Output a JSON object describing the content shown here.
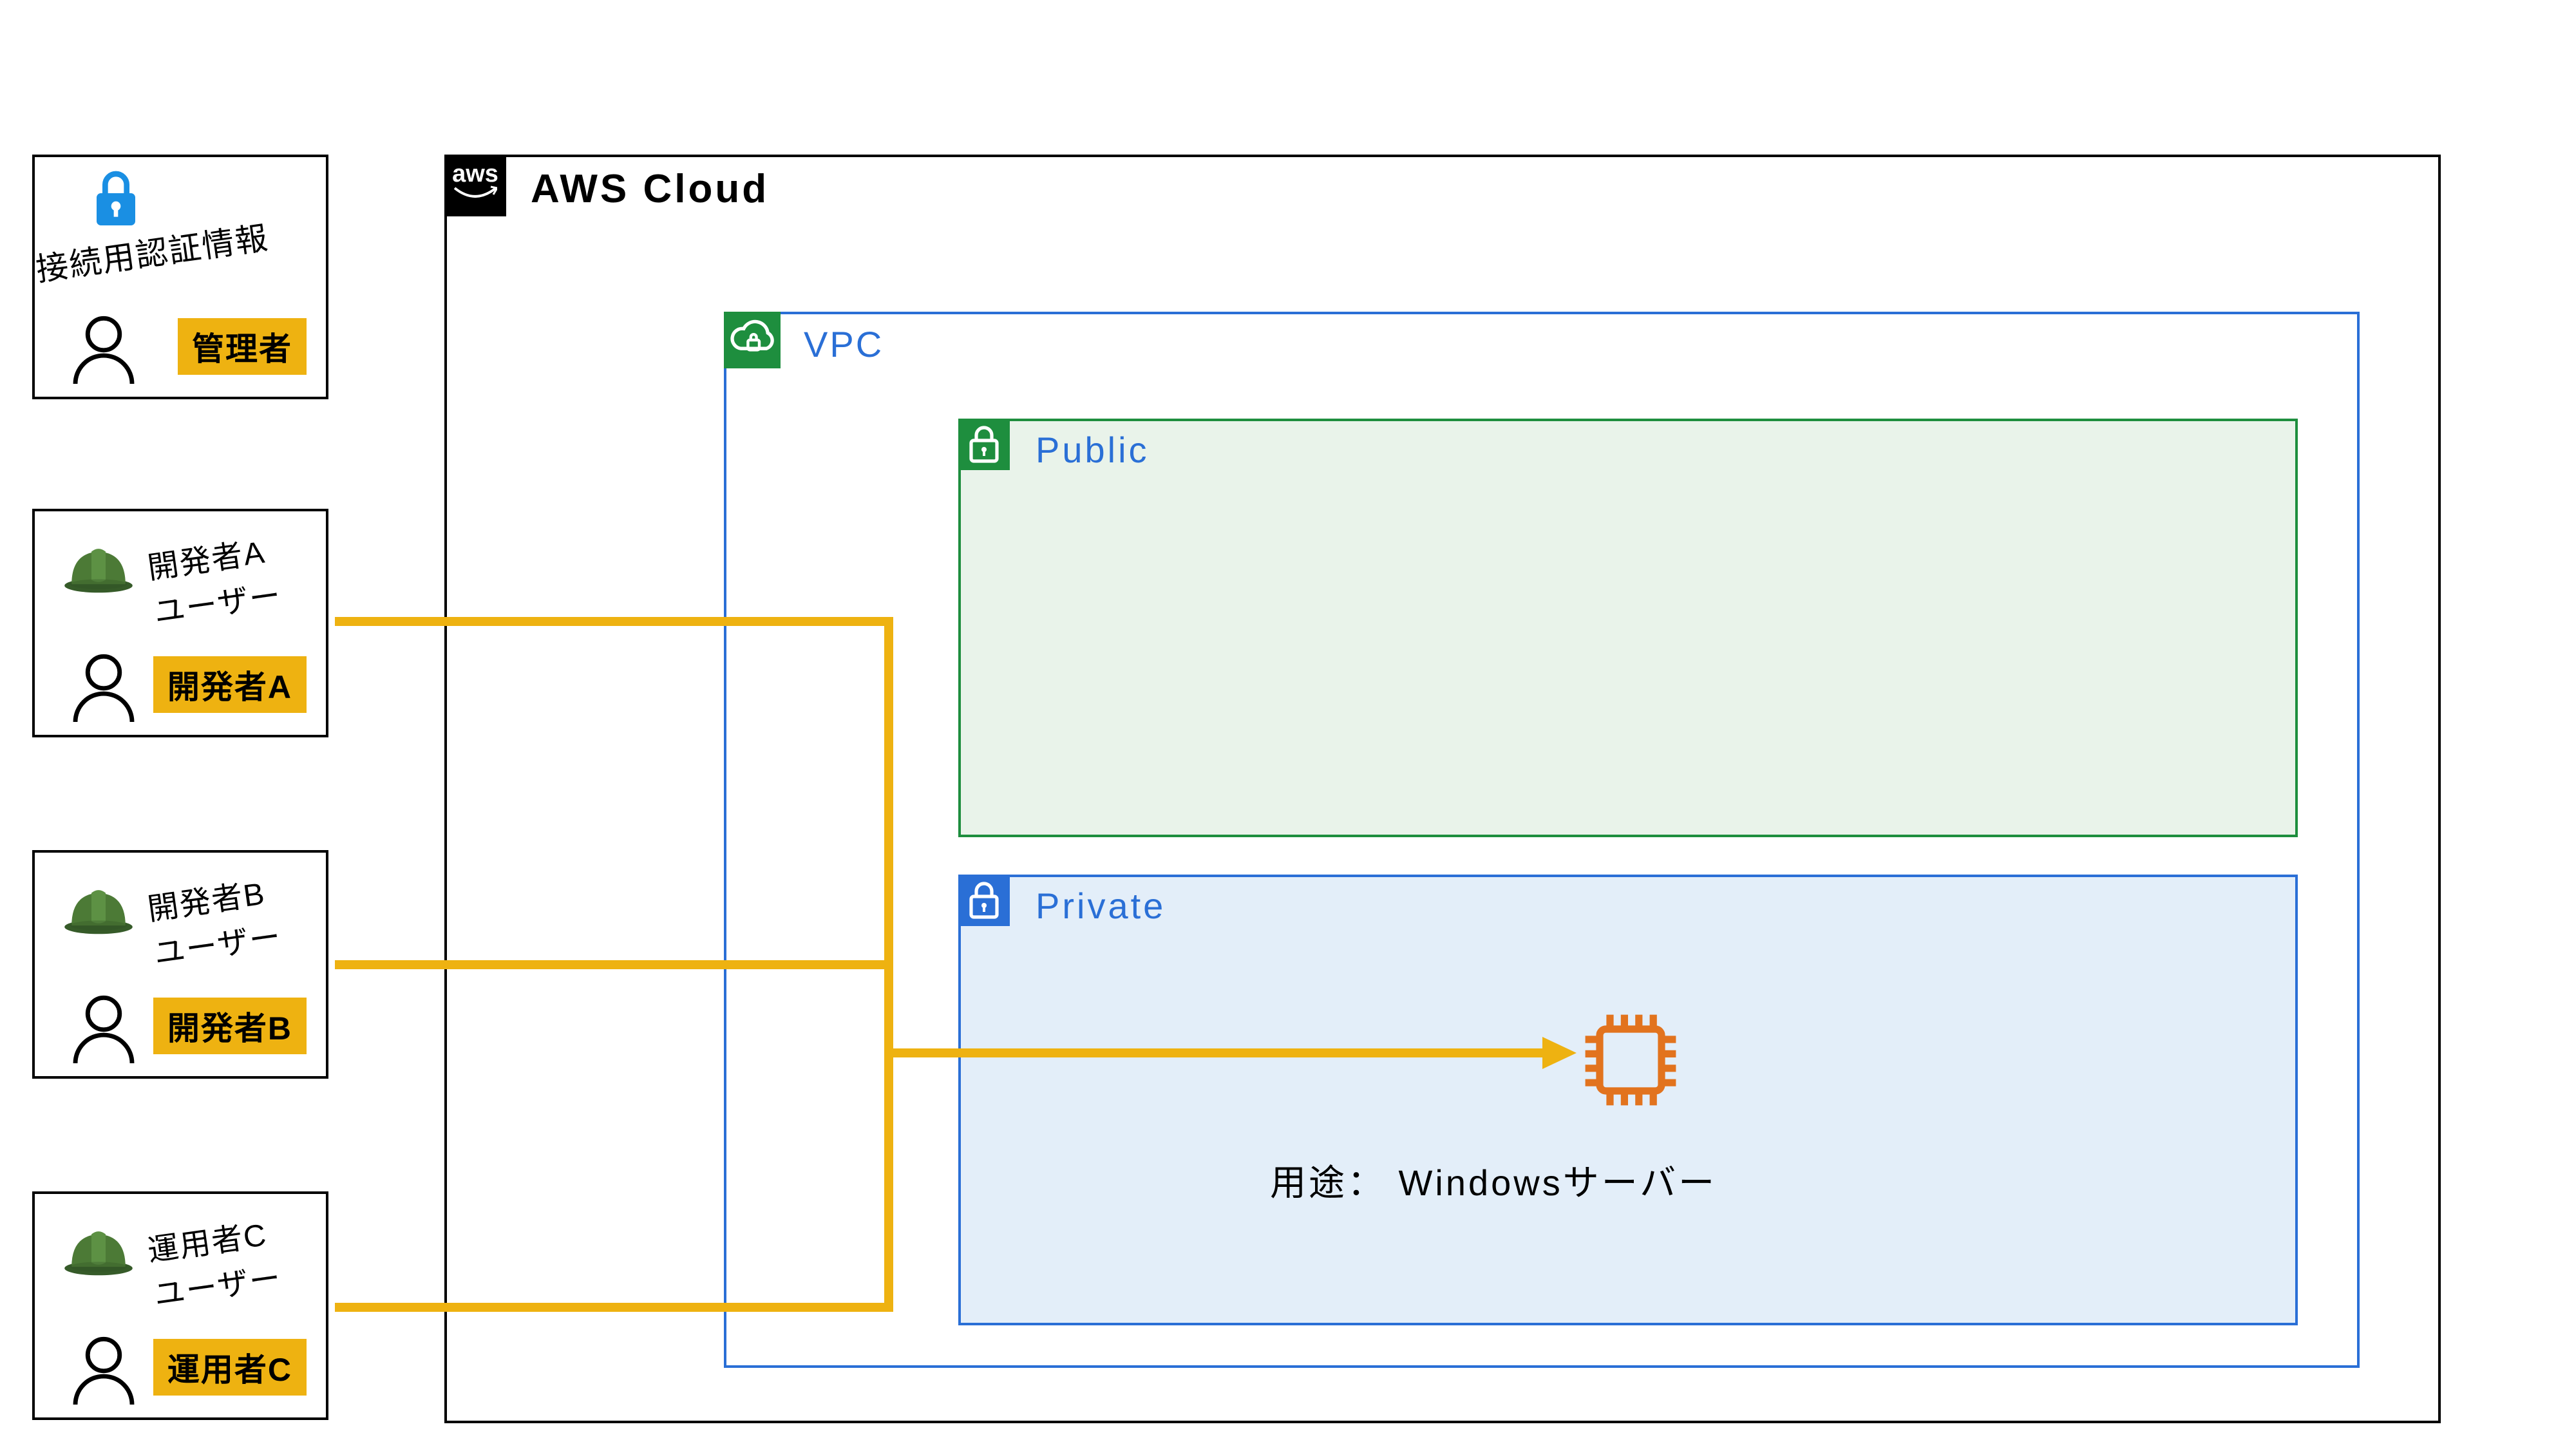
{
  "admin_card": {
    "title": "接続用認証情報",
    "role": "管理者"
  },
  "users": [
    {
      "title1": "開発者A",
      "title2": "ユーザー",
      "role": "開発者A"
    },
    {
      "title1": "開発者B",
      "title2": "ユーザー",
      "role": "開発者B"
    },
    {
      "title1": "運用者C",
      "title2": "ユーザー",
      "role": "運用者C"
    }
  ],
  "cloud": {
    "provider_short": "aws",
    "label": "AWS Cloud"
  },
  "vpc": {
    "label": "VPC"
  },
  "subnets": {
    "public": {
      "label": "Public"
    },
    "private": {
      "label": "Private"
    }
  },
  "server": {
    "caption": "用途： Windowsサーバー"
  },
  "colors": {
    "accent_orange": "#eeb211",
    "aws_blue": "#2a6fd6",
    "aws_green": "#1e8e3e",
    "ec2_orange": "#e2731e"
  }
}
